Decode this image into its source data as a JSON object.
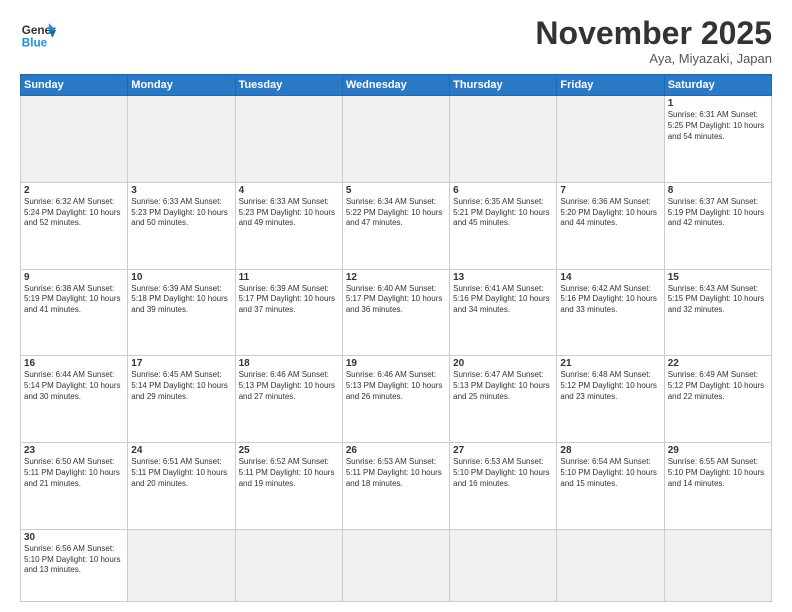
{
  "header": {
    "logo_general": "General",
    "logo_blue": "Blue",
    "month_title": "November 2025",
    "location": "Aya, Miyazaki, Japan"
  },
  "weekdays": [
    "Sunday",
    "Monday",
    "Tuesday",
    "Wednesday",
    "Thursday",
    "Friday",
    "Saturday"
  ],
  "weeks": [
    [
      {
        "day": "",
        "info": "",
        "empty": true
      },
      {
        "day": "",
        "info": "",
        "empty": true
      },
      {
        "day": "",
        "info": "",
        "empty": true
      },
      {
        "day": "",
        "info": "",
        "empty": true
      },
      {
        "day": "",
        "info": "",
        "empty": true
      },
      {
        "day": "",
        "info": "",
        "empty": true
      },
      {
        "day": "1",
        "info": "Sunrise: 6:31 AM\nSunset: 5:25 PM\nDaylight: 10 hours\nand 54 minutes."
      }
    ],
    [
      {
        "day": "2",
        "info": "Sunrise: 6:32 AM\nSunset: 5:24 PM\nDaylight: 10 hours\nand 52 minutes."
      },
      {
        "day": "3",
        "info": "Sunrise: 6:33 AM\nSunset: 5:23 PM\nDaylight: 10 hours\nand 50 minutes."
      },
      {
        "day": "4",
        "info": "Sunrise: 6:33 AM\nSunset: 5:23 PM\nDaylight: 10 hours\nand 49 minutes."
      },
      {
        "day": "5",
        "info": "Sunrise: 6:34 AM\nSunset: 5:22 PM\nDaylight: 10 hours\nand 47 minutes."
      },
      {
        "day": "6",
        "info": "Sunrise: 6:35 AM\nSunset: 5:21 PM\nDaylight: 10 hours\nand 45 minutes."
      },
      {
        "day": "7",
        "info": "Sunrise: 6:36 AM\nSunset: 5:20 PM\nDaylight: 10 hours\nand 44 minutes."
      },
      {
        "day": "8",
        "info": "Sunrise: 6:37 AM\nSunset: 5:19 PM\nDaylight: 10 hours\nand 42 minutes."
      }
    ],
    [
      {
        "day": "9",
        "info": "Sunrise: 6:38 AM\nSunset: 5:19 PM\nDaylight: 10 hours\nand 41 minutes."
      },
      {
        "day": "10",
        "info": "Sunrise: 6:39 AM\nSunset: 5:18 PM\nDaylight: 10 hours\nand 39 minutes."
      },
      {
        "day": "11",
        "info": "Sunrise: 6:39 AM\nSunset: 5:17 PM\nDaylight: 10 hours\nand 37 minutes."
      },
      {
        "day": "12",
        "info": "Sunrise: 6:40 AM\nSunset: 5:17 PM\nDaylight: 10 hours\nand 36 minutes."
      },
      {
        "day": "13",
        "info": "Sunrise: 6:41 AM\nSunset: 5:16 PM\nDaylight: 10 hours\nand 34 minutes."
      },
      {
        "day": "14",
        "info": "Sunrise: 6:42 AM\nSunset: 5:16 PM\nDaylight: 10 hours\nand 33 minutes."
      },
      {
        "day": "15",
        "info": "Sunrise: 6:43 AM\nSunset: 5:15 PM\nDaylight: 10 hours\nand 32 minutes."
      }
    ],
    [
      {
        "day": "16",
        "info": "Sunrise: 6:44 AM\nSunset: 5:14 PM\nDaylight: 10 hours\nand 30 minutes."
      },
      {
        "day": "17",
        "info": "Sunrise: 6:45 AM\nSunset: 5:14 PM\nDaylight: 10 hours\nand 29 minutes."
      },
      {
        "day": "18",
        "info": "Sunrise: 6:46 AM\nSunset: 5:13 PM\nDaylight: 10 hours\nand 27 minutes."
      },
      {
        "day": "19",
        "info": "Sunrise: 6:46 AM\nSunset: 5:13 PM\nDaylight: 10 hours\nand 26 minutes."
      },
      {
        "day": "20",
        "info": "Sunrise: 6:47 AM\nSunset: 5:13 PM\nDaylight: 10 hours\nand 25 minutes."
      },
      {
        "day": "21",
        "info": "Sunrise: 6:48 AM\nSunset: 5:12 PM\nDaylight: 10 hours\nand 23 minutes."
      },
      {
        "day": "22",
        "info": "Sunrise: 6:49 AM\nSunset: 5:12 PM\nDaylight: 10 hours\nand 22 minutes."
      }
    ],
    [
      {
        "day": "23",
        "info": "Sunrise: 6:50 AM\nSunset: 5:11 PM\nDaylight: 10 hours\nand 21 minutes."
      },
      {
        "day": "24",
        "info": "Sunrise: 6:51 AM\nSunset: 5:11 PM\nDaylight: 10 hours\nand 20 minutes."
      },
      {
        "day": "25",
        "info": "Sunrise: 6:52 AM\nSunset: 5:11 PM\nDaylight: 10 hours\nand 19 minutes."
      },
      {
        "day": "26",
        "info": "Sunrise: 6:53 AM\nSunset: 5:11 PM\nDaylight: 10 hours\nand 18 minutes."
      },
      {
        "day": "27",
        "info": "Sunrise: 6:53 AM\nSunset: 5:10 PM\nDaylight: 10 hours\nand 16 minutes."
      },
      {
        "day": "28",
        "info": "Sunrise: 6:54 AM\nSunset: 5:10 PM\nDaylight: 10 hours\nand 15 minutes."
      },
      {
        "day": "29",
        "info": "Sunrise: 6:55 AM\nSunset: 5:10 PM\nDaylight: 10 hours\nand 14 minutes."
      }
    ],
    [
      {
        "day": "30",
        "info": "Sunrise: 6:56 AM\nSunset: 5:10 PM\nDaylight: 10 hours\nand 13 minutes.",
        "last": true
      },
      {
        "day": "",
        "info": "",
        "empty": true,
        "last": true
      },
      {
        "day": "",
        "info": "",
        "empty": true,
        "last": true
      },
      {
        "day": "",
        "info": "",
        "empty": true,
        "last": true
      },
      {
        "day": "",
        "info": "",
        "empty": true,
        "last": true
      },
      {
        "day": "",
        "info": "",
        "empty": true,
        "last": true
      },
      {
        "day": "",
        "info": "",
        "empty": true,
        "last": true
      }
    ]
  ]
}
